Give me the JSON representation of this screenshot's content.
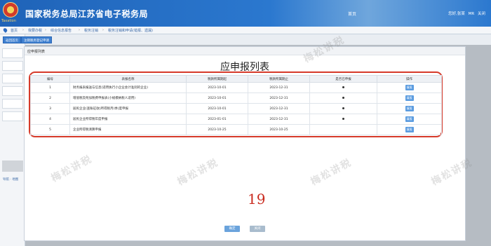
{
  "header": {
    "title": "国家税务总局江苏省电子税务局",
    "emblem_caption": "Taxation",
    "nav_home": "首页",
    "user_links": [
      "您好,张某",
      "MR",
      "关闭"
    ]
  },
  "breadcrumb": [
    "首页",
    "我要办税",
    "综合信息报告",
    "税务注销",
    "税务注销和申请(错报、遗漏)"
  ],
  "sub_buttons": [
    "返回首页",
    "注销税务登记申请"
  ],
  "left_panel": {
    "link_text": "导航 · 地图"
  },
  "modal": {
    "tab_label": "应申报列表",
    "title": "应申报列表",
    "columns": [
      "编号",
      "表报名称",
      "税款所属期起",
      "税款所属期止",
      "是否已申报",
      "操作"
    ],
    "rows": [
      {
        "no": "1",
        "name": "财务报表报送与信息(适用执行小企业会计准则的企业)",
        "start": "2023-10-01",
        "end": "2023-12-31",
        "declared": true,
        "action": "填报"
      },
      {
        "no": "2",
        "name": "增值税及附加税费申报表(小规模纳税人适用)",
        "start": "2023-10-01",
        "end": "2023-12-31",
        "declared": true,
        "action": "填报"
      },
      {
        "no": "3",
        "name": "居民企业(查账征收)所得税月(季)度申报",
        "start": "2023-10-01",
        "end": "2023-12-31",
        "declared": true,
        "action": "填报"
      },
      {
        "no": "4",
        "name": "居民企业所得税年度申报",
        "start": "2023-01-01",
        "end": "2023-12-31",
        "declared": true,
        "action": "填报"
      },
      {
        "no": "5",
        "name": "企业所得税清算申报",
        "start": "2023-10-25",
        "end": "2023-10-25",
        "declared": false,
        "action": "填报"
      }
    ],
    "annotation": "19",
    "footer_buttons": [
      "确定",
      "关闭"
    ]
  },
  "watermark_text": "梅松讲税",
  "colors": {
    "header_blue": "#2b78cf",
    "accent_red": "#d63a2a",
    "button_blue": "#5b9ce0"
  }
}
